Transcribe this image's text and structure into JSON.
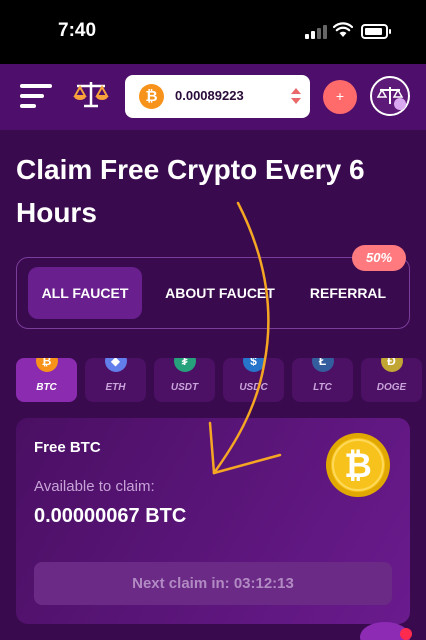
{
  "status_bar": {
    "time": "7:40"
  },
  "header": {
    "balance": "0.00089223",
    "add_label": "+"
  },
  "page_title": "Claim Free Crypto Every 6 Hours",
  "tabs": [
    {
      "label": "ALL FAUCET",
      "active": true
    },
    {
      "label": "ABOUT FAUCET",
      "active": false
    },
    {
      "label": "REFERRAL",
      "active": false
    }
  ],
  "referral_badge": "50%",
  "coins": [
    {
      "symbol": "BTC",
      "color": "#f7931a",
      "glyph": "₿",
      "active": true
    },
    {
      "symbol": "ETH",
      "color": "#627eea",
      "glyph": "◆",
      "active": false
    },
    {
      "symbol": "USDT",
      "color": "#26a17b",
      "glyph": "₮",
      "active": false
    },
    {
      "symbol": "USDC",
      "color": "#2775ca",
      "glyph": "$",
      "active": false
    },
    {
      "symbol": "LTC",
      "color": "#345d9d",
      "glyph": "Ł",
      "active": false
    },
    {
      "symbol": "DOGE",
      "color": "#c2a633",
      "glyph": "Ð",
      "active": false
    }
  ],
  "card": {
    "title": "Free BTC",
    "available_label": "Available to claim:",
    "amount": "0.00000067 BTC",
    "next_claim": "Next claim in: 03:12:13"
  },
  "colors": {
    "background": "#3a0a4f",
    "header": "#4e0e6b",
    "accent": "#ff6b6b",
    "bitcoin": "#f7931a"
  }
}
